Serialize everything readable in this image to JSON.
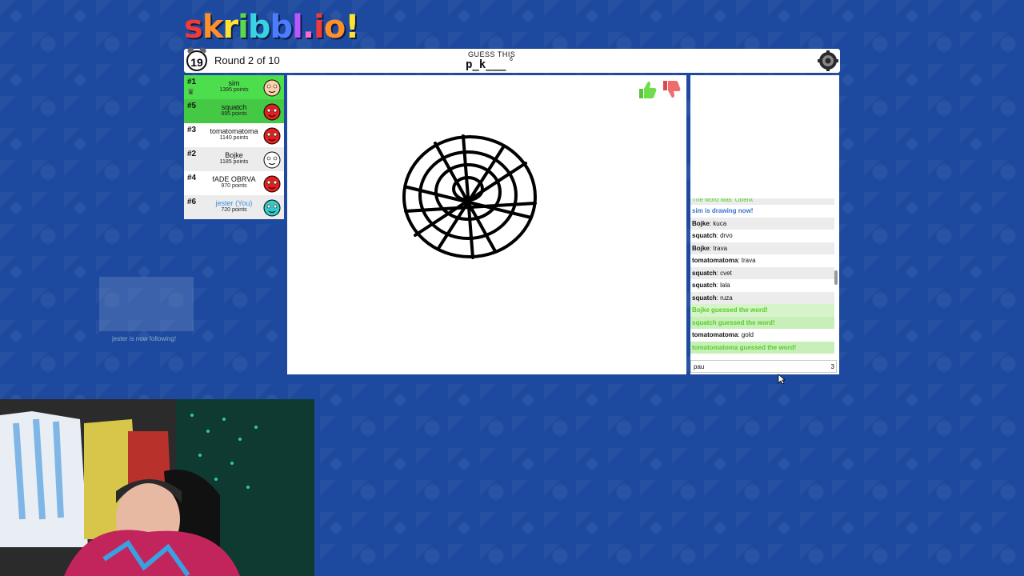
{
  "logo": {
    "letters": [
      "s",
      "k",
      "r",
      "i",
      "b",
      "b",
      "l",
      ".",
      "i",
      "o",
      "!"
    ],
    "colors": [
      "#ef3a3a",
      "#ff8f2b",
      "#ffe133",
      "#5ad94f",
      "#3ad1e0",
      "#4d7cff",
      "#b956ff",
      "#ff6ad0",
      "#ef3a3a",
      "#ff8f2b",
      "#ffe133"
    ]
  },
  "header": {
    "timer": "19",
    "round_text": "Round 2 of 10",
    "guess_label": "GUESS THIS",
    "word_hint": "p_k___",
    "word_length": "6"
  },
  "players": [
    {
      "rank": "#1",
      "name": "sim",
      "points": "1395 points",
      "guessed": true,
      "is_drawing": true,
      "you": false,
      "avatar_color": "#ffd0a8"
    },
    {
      "rank": "#5",
      "name": "squatch",
      "points": "895 points",
      "guessed": true,
      "is_drawing": false,
      "you": false,
      "avatar_color": "#e02020"
    },
    {
      "rank": "#3",
      "name": "tomatomatoma",
      "points": "1140 points",
      "guessed": false,
      "is_drawing": false,
      "you": false,
      "avatar_color": "#e02020"
    },
    {
      "rank": "#2",
      "name": "Bojke",
      "points": "1185 points",
      "guessed": false,
      "is_drawing": false,
      "you": false,
      "avatar_color": "#ffffff"
    },
    {
      "rank": "#4",
      "name": "fADE OBRVA",
      "points": "970 points",
      "guessed": false,
      "is_drawing": false,
      "you": false,
      "avatar_color": "#e02020"
    },
    {
      "rank": "#6",
      "name": "jester (You)",
      "points": "720 points",
      "guessed": false,
      "is_drawing": false,
      "you": true,
      "avatar_color": "#33c9c9"
    }
  ],
  "chat": {
    "messages": [
      {
        "type": "partial",
        "author": "",
        "text": "The word was 'Obelix'"
      },
      {
        "type": "system",
        "author": "",
        "text": "sim is drawing now!"
      },
      {
        "type": "chat",
        "author": "Bojke",
        "text": "kuca"
      },
      {
        "type": "chat",
        "author": "squatch",
        "text": "drvo"
      },
      {
        "type": "chat",
        "author": "Bojke",
        "text": "trava"
      },
      {
        "type": "chat",
        "author": "tomatomatoma",
        "text": "trava"
      },
      {
        "type": "chat",
        "author": "squatch",
        "text": "cvet"
      },
      {
        "type": "chat",
        "author": "squatch",
        "text": "lala"
      },
      {
        "type": "chat",
        "author": "squatch",
        "text": "ruza"
      },
      {
        "type": "guessed",
        "author": "",
        "text": "Bojke guessed the word!"
      },
      {
        "type": "guessed",
        "author": "",
        "text": "squatch guessed the word!"
      },
      {
        "type": "chat",
        "author": "tomatomatoma",
        "text": "gold"
      },
      {
        "type": "guessed",
        "author": "",
        "text": "tomatomatoma guessed the word!"
      }
    ],
    "input_value": "pau",
    "char_count": "3"
  },
  "overlay": {
    "follow_text": "jester is now following!"
  },
  "colors": {
    "background": "#1d4a9e",
    "guessed": "#4dde4d",
    "chat_green": "#56ce27",
    "chat_blue": "#3975ce"
  }
}
